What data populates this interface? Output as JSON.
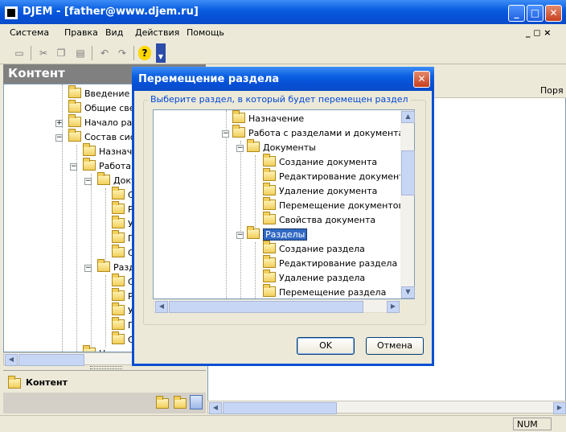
{
  "window": {
    "title": "DJEM - [father@www.djem.ru]",
    "btn_min": "_",
    "btn_max": "□",
    "btn_close": "✕"
  },
  "menu": {
    "items": [
      "Система",
      "Правка",
      "Вид",
      "Действия",
      "Помощь"
    ],
    "mdi_controls": "_ ◻ ×"
  },
  "toolbar": {
    "icons": [
      "new-document-icon",
      "cut-icon",
      "copy-icon",
      "paste-icon",
      "undo-icon",
      "redo-icon",
      "help-icon",
      "dropdown-arrow-icon"
    ]
  },
  "left_panel": {
    "header": "Контент",
    "tree": [
      {
        "label": "Введение"
      },
      {
        "label": "Общие свед"
      },
      {
        "label": "Начало раб"
      },
      {
        "label": "Состав сист"
      },
      {
        "label": "Назначе"
      },
      {
        "label": "Работа с"
      },
      {
        "label": "Доку"
      },
      {
        "label": "С"
      },
      {
        "label": "Р"
      },
      {
        "label": "У"
      },
      {
        "label": "П"
      },
      {
        "label": "С"
      },
      {
        "label": "Разд"
      },
      {
        "label": "С"
      },
      {
        "label": "Р"
      },
      {
        "label": "У"
      },
      {
        "label": "П"
      },
      {
        "label": "С"
      },
      {
        "label": "Н"
      }
    ],
    "bottom_title": "Контент"
  },
  "right_panel": {
    "column_header": "Поря"
  },
  "status_bar": {
    "num": "NUM"
  },
  "dialog": {
    "title": "Перемещение раздела",
    "group_label": "Выберите раздел, в который будет перемещен раздел",
    "tree": [
      {
        "label": "Назначение"
      },
      {
        "label": "Работа с разделами и документами"
      },
      {
        "label": "Документы"
      },
      {
        "label": "Создание документа"
      },
      {
        "label": "Редактирование документа"
      },
      {
        "label": "Удаление документа"
      },
      {
        "label": "Перемещение документов"
      },
      {
        "label": "Свойства документа"
      },
      {
        "label": "Разделы"
      },
      {
        "label": "Создание раздела"
      },
      {
        "label": "Редактирование раздела"
      },
      {
        "label": "Удаление раздела"
      },
      {
        "label": "Перемещение раздела"
      }
    ],
    "ok_label": "OK",
    "cancel_label": "Отмена"
  }
}
